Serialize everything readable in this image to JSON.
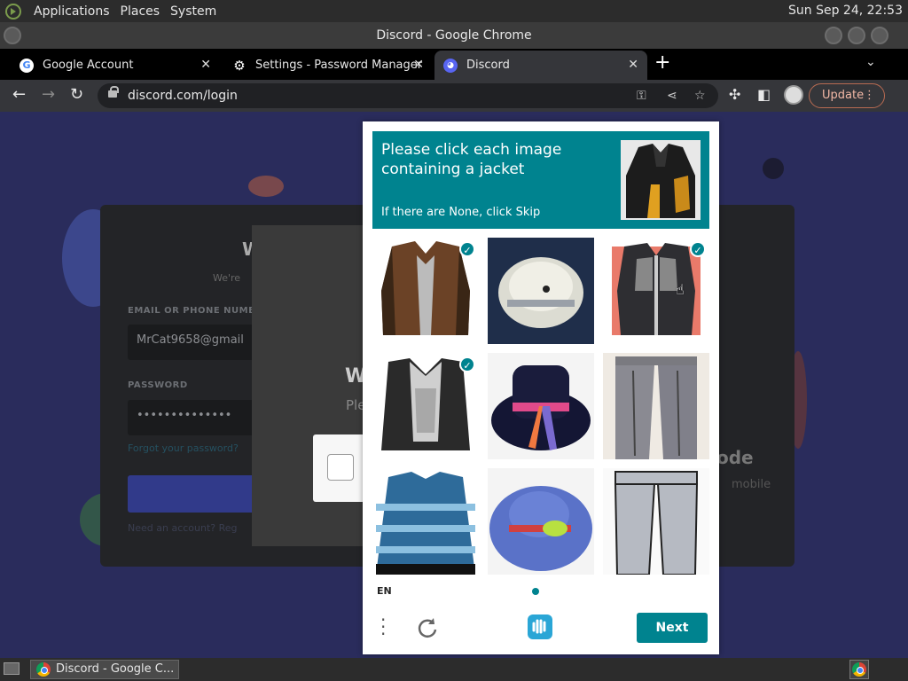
{
  "top_panel": {
    "menus": [
      "Applications",
      "Places",
      "System"
    ],
    "clock": "Sun Sep 24, 22:53"
  },
  "window": {
    "title": "Discord - Google Chrome"
  },
  "tabs": [
    {
      "label": "Google Account",
      "icon": "google-icon"
    },
    {
      "label": "Settings - Password Manager",
      "icon": "gear-icon"
    },
    {
      "label": "Discord",
      "icon": "discord-icon",
      "active": true
    }
  ],
  "toolbar": {
    "url": "discord.com/login",
    "update_label": "Update"
  },
  "login": {
    "title": "W",
    "subtitle": "We're",
    "email_label": "EMAIL OR PHONE NUMB",
    "email_value": "MrCat9658@gmail",
    "password_label": "PASSWORD",
    "password_value": "••••••••••••••",
    "forgot_text": "Forgot your password?",
    "register_text": "Need an account? Reg",
    "modal_title": "W",
    "modal_sub": "Ple",
    "qr_title": "ode",
    "qr_sub": "mobile"
  },
  "captcha": {
    "prompt": "Please click each image containing a jacket",
    "skip_hint": "If there are None, click Skip",
    "language": "EN",
    "next_label": "Next",
    "tiles": [
      {
        "name": "tile-brown-leather-jacket",
        "selected": true
      },
      {
        "name": "tile-white-hat",
        "selected": false
      },
      {
        "name": "tile-grey-leather-jacket",
        "selected": true
      },
      {
        "name": "tile-sequin-vest",
        "selected": true
      },
      {
        "name": "tile-black-hat",
        "selected": false
      },
      {
        "name": "tile-grey-trousers",
        "selected": false
      },
      {
        "name": "tile-blue-sweater",
        "selected": false
      },
      {
        "name": "tile-blue-hat",
        "selected": false
      },
      {
        "name": "tile-grey-pants",
        "selected": false
      }
    ]
  },
  "taskbar": {
    "window_label": "Discord - Google C..."
  },
  "colors": {
    "captcha_teal": "#00838f",
    "discord_bg": "#2a2c5c",
    "update_accent": "#f2b8a6"
  }
}
